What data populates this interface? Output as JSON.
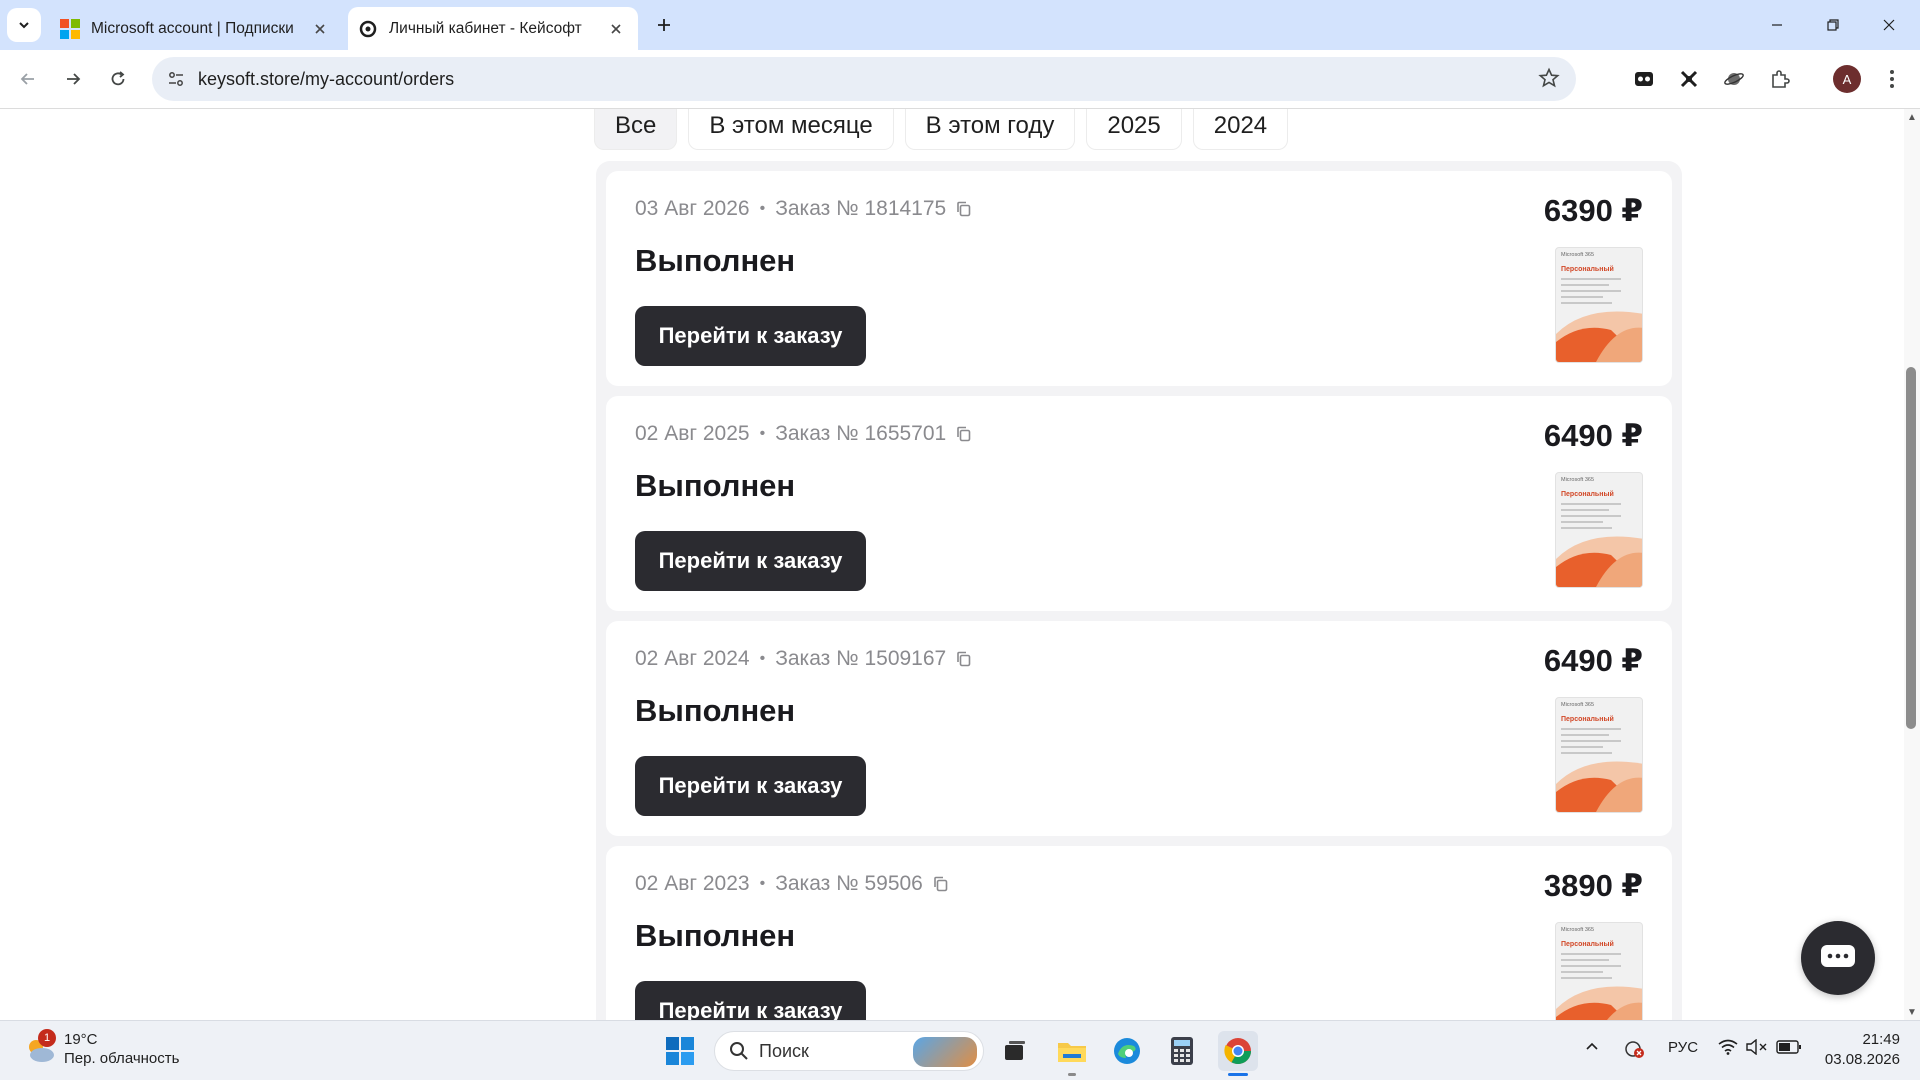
{
  "browser": {
    "tabs": [
      {
        "title": "Microsoft account | Подписки",
        "active": false,
        "favicon": "microsoft-logo"
      },
      {
        "title": "Личный кабинет - Кейсофт",
        "active": true,
        "favicon": "keysoft-logo"
      }
    ],
    "url": "keysoft.store/my-account/orders",
    "profile_initial": "A"
  },
  "filters": [
    "Все",
    "В этом месяце",
    "В этом году",
    "2025",
    "2024"
  ],
  "selected_filter": "Все",
  "orders": [
    {
      "date": "03 Авг 2026",
      "number": "Заказ № 1814175",
      "status": "Выполнен",
      "price": "6390 ₽",
      "button": "Перейти к заказу"
    },
    {
      "date": "02 Авг 2025",
      "number": "Заказ № 1655701",
      "status": "Выполнен",
      "price": "6490 ₽",
      "button": "Перейти к заказу"
    },
    {
      "date": "02 Авг 2024",
      "number": "Заказ № 1509167",
      "status": "Выполнен",
      "price": "6490 ₽",
      "button": "Перейти к заказу"
    },
    {
      "date": "02 Авг 2023",
      "number": "Заказ № 59506",
      "status": "Выполнен",
      "price": "3890 ₽",
      "button": "Перейти к заказу"
    }
  ],
  "product_thumb": {
    "brand": "Microsoft 365",
    "title": "Персональный"
  },
  "taskbar": {
    "weather_temp": "19°C",
    "weather_desc": "Пер. облачность",
    "weather_badge": "1",
    "search_placeholder": "Поиск",
    "language": "РУС",
    "time": "21:49",
    "date": "03.08.2026"
  },
  "colors": {
    "tabstrip": "#d3e3fd",
    "button_dark": "#2b2b30",
    "panel_bg": "#f3f3f5",
    "office_orange": "#e8602c"
  }
}
